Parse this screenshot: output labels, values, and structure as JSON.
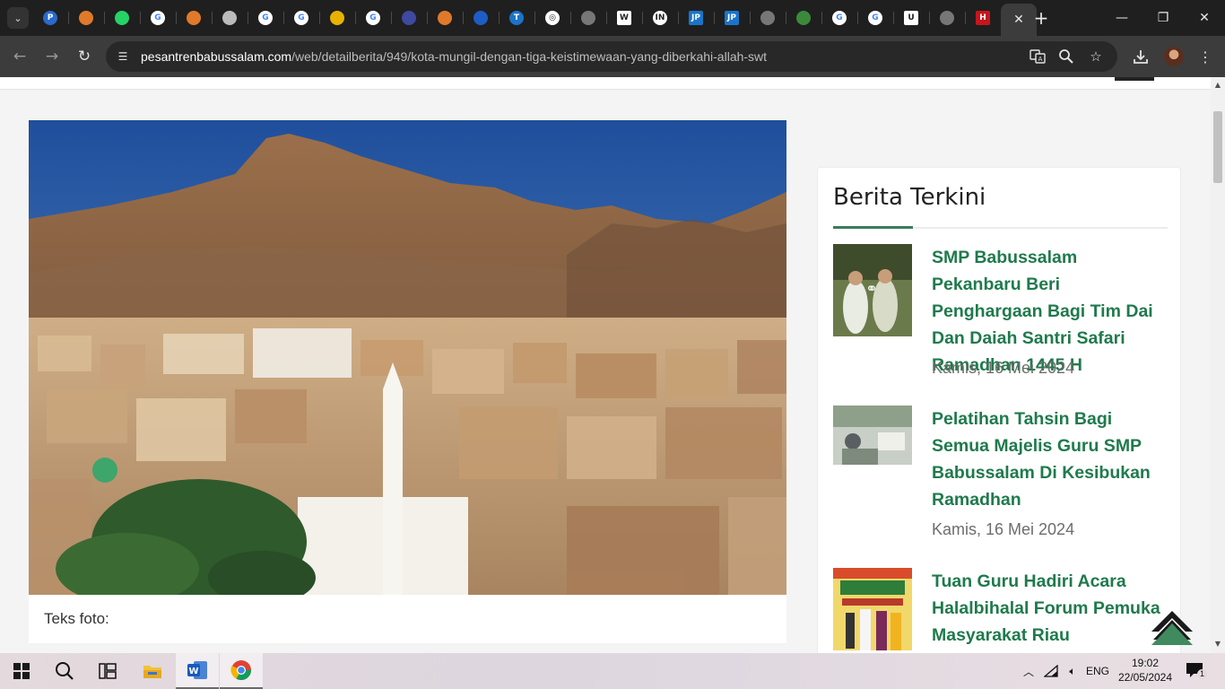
{
  "browser": {
    "tabs": [
      {
        "icon": "pesantren-favicon-icon",
        "color": "#2a6acb",
        "glyph": "P"
      },
      {
        "icon": "pesantren-favicon-icon",
        "color": "#e07a2a",
        "glyph": ""
      },
      {
        "icon": "whatsapp-icon",
        "color": "#25d366",
        "glyph": ""
      },
      {
        "icon": "google-icon",
        "color": "#ffffff",
        "glyph": "G"
      },
      {
        "icon": "pesantren-favicon-icon",
        "color": "#e07a2a",
        "glyph": ""
      },
      {
        "icon": "chrome-icon",
        "color": "#bbbbbb",
        "glyph": ""
      },
      {
        "icon": "google-icon",
        "color": "#ffffff",
        "glyph": "G"
      },
      {
        "icon": "google-icon",
        "color": "#ffffff",
        "glyph": "G"
      },
      {
        "icon": "news-site-icon",
        "color": "#e9b200",
        "glyph": ""
      },
      {
        "icon": "google-icon",
        "color": "#ffffff",
        "glyph": "G"
      },
      {
        "icon": "globe-seal-icon",
        "color": "#3d4aa0",
        "glyph": ""
      },
      {
        "icon": "pesantren-favicon-icon",
        "color": "#e07a2a",
        "glyph": ""
      },
      {
        "icon": "flag-icon",
        "color": "#1e5cc6",
        "glyph": ""
      },
      {
        "icon": "tribun-icon",
        "color": "#1b74c9",
        "glyph": "T"
      },
      {
        "icon": "instagram-icon",
        "color": "#ffffff",
        "glyph": "◎"
      },
      {
        "icon": "globe-icon",
        "color": "#777777",
        "glyph": ""
      },
      {
        "icon": "wikipedia-icon",
        "color": "#ffffff",
        "glyph": "W"
      },
      {
        "icon": "idn-icon",
        "color": "#ffffff",
        "glyph": "IN"
      },
      {
        "icon": "jawapos-icon",
        "color": "#1b74c9",
        "glyph": "JP"
      },
      {
        "icon": "jawapos-icon",
        "color": "#1b74c9",
        "glyph": "JP"
      },
      {
        "icon": "globe-icon",
        "color": "#777777",
        "glyph": ""
      },
      {
        "icon": "leaf-icon",
        "color": "#3b8a3b",
        "glyph": ""
      },
      {
        "icon": "google-icon",
        "color": "#ffffff",
        "glyph": "G"
      },
      {
        "icon": "google-icon",
        "color": "#ffffff",
        "glyph": "G"
      },
      {
        "icon": "brand-u-icon",
        "color": "#ffffff",
        "glyph": "U"
      },
      {
        "icon": "globe-icon",
        "color": "#777777",
        "glyph": ""
      },
      {
        "icon": "h-logo-icon",
        "color": "#c4161c",
        "glyph": "H"
      }
    ],
    "active_tab_close": "✕",
    "new_tab": "+",
    "url": {
      "host": "pesantrenbabussalam.com",
      "path": "/web/detailberita/949/kota-mungil-dengan-tiga-keistimewaan-yang-diberkahi-allah-swt"
    }
  },
  "page": {
    "caption": "Teks foto:",
    "sidebar": {
      "title": "Berita Terkini",
      "items": [
        {
          "title": "SMP Babussalam Pekanbaru Beri Penghargaan Bagi Tim Dai Dan Daiah Santri Safari Ramadhan 1445 H",
          "date": "Kamis, 16 Mei 2024"
        },
        {
          "title": "Pelatihan Tahsin Bagi Semua Majelis Guru SMP Babussalam Di Kesibukan Ramadhan",
          "date": "Kamis, 16 Mei 2024"
        },
        {
          "title": "Tuan Guru Hadiri Acara Halalbihalal Forum Pemuka Masyarakat Riau",
          "date": ""
        }
      ]
    },
    "accent_color": "#1f7a4c"
  },
  "taskbar": {
    "language": "ENG",
    "time": "19:02",
    "date": "22/05/2024",
    "notification_count": "1"
  }
}
